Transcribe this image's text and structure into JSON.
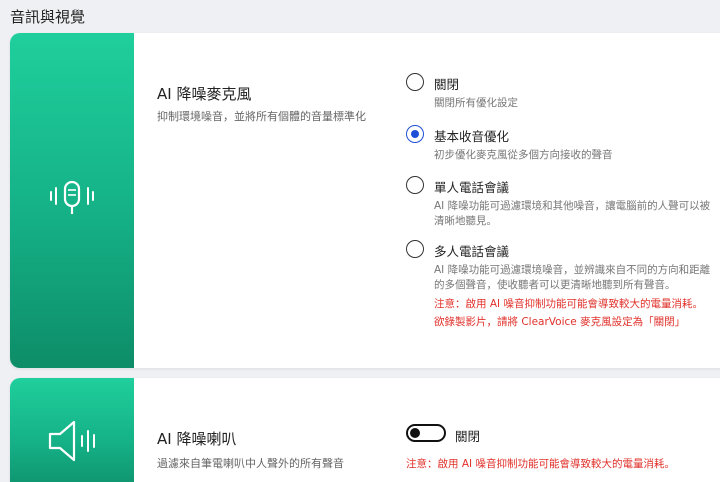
{
  "section_title": "音訊與視覺",
  "mic_card": {
    "title": "AI 降噪麥克風",
    "description": "抑制環境噪音，並將所有個體的音量標準化",
    "icon": "microphone-icon",
    "options": [
      {
        "label": "關閉",
        "desc": "關閉所有優化設定",
        "selected": false
      },
      {
        "label": "基本收音優化",
        "desc": "初步優化麥克風從多個方向接收的聲音",
        "selected": true
      },
      {
        "label": "單人電話會議",
        "desc": "AI 降噪功能可過濾環境和其他噪音，讓電腦前的人聲可以被清晰地聽見。",
        "selected": false
      },
      {
        "label": "多人電話會議",
        "desc": "AI 降噪功能可過濾環境噪音，並辨識來自不同的方向和距離的多個聲音，使收聽者可以更清晰地聽到所有聲音。",
        "selected": false
      }
    ],
    "warning_line1": "注意：啟用 AI 噪音抑制功能可能會導致較大的電量消耗。",
    "warning_line2": "欲錄製影片，請將 ClearVoice 麥克風設定為「關閉」"
  },
  "speaker_card": {
    "title": "AI 降噪喇叭",
    "description": "過濾來自筆電喇叭中人聲外的所有聲音",
    "icon": "speaker-icon",
    "toggle_state_label": "關閉",
    "toggle_on": false,
    "warning": "注意：啟用 AI 噪音抑制功能可能會導致較大的電量消耗。"
  },
  "colors": {
    "accent": "#1f4fd6",
    "side_panel": "#15b086",
    "warning": "#e0302a"
  }
}
